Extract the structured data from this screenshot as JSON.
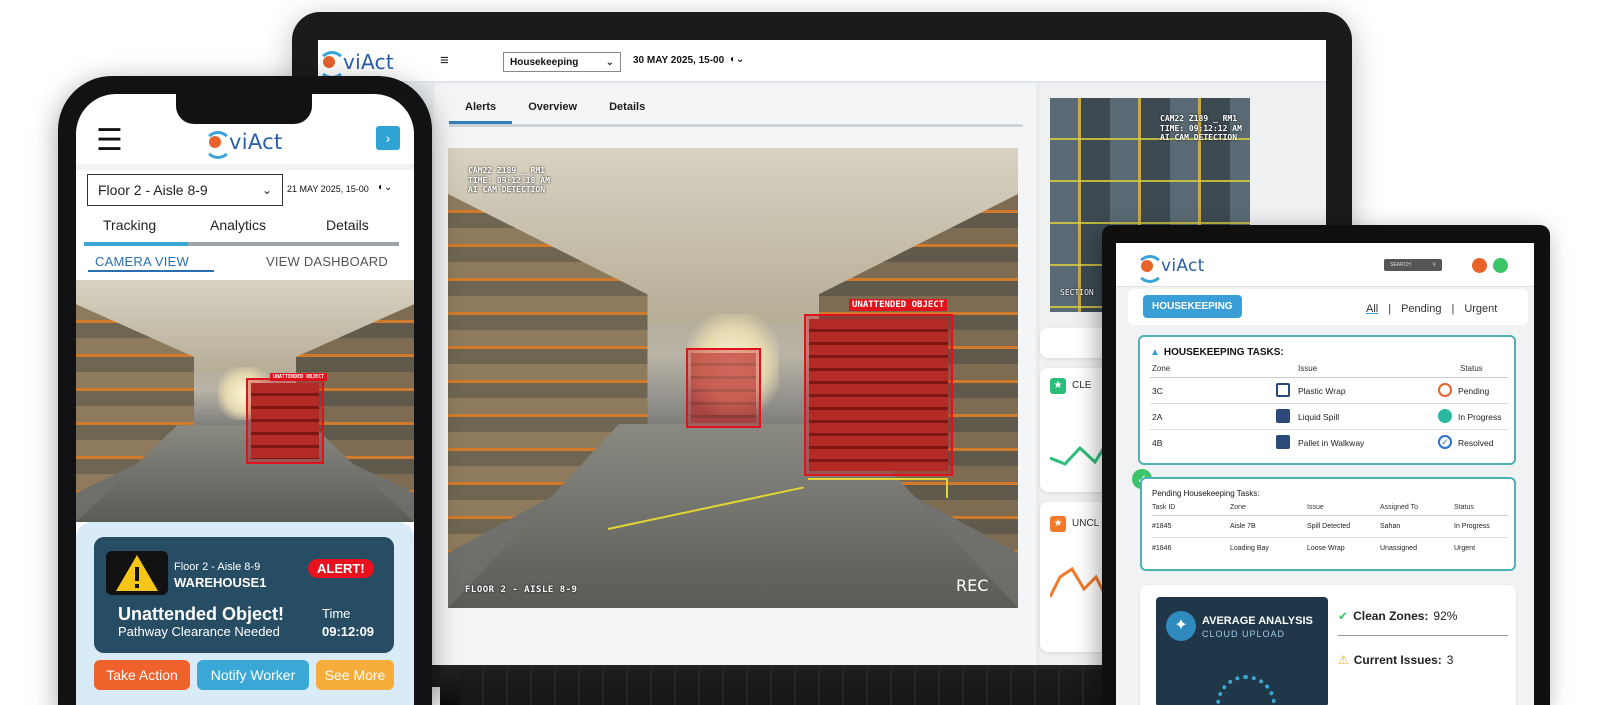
{
  "laptop": {
    "logo_text": "viAct",
    "category_select": "Housekeeping",
    "datetime": "30 MAY 2025, 15-00",
    "tabs": [
      {
        "label": "Alerts",
        "active": true
      },
      {
        "label": "Overview",
        "active": false
      },
      {
        "label": "Details",
        "active": false
      }
    ],
    "main_camera": {
      "overlay": [
        "CAM22 Z189 _ RM1",
        "TIME: 09:12:18 AM",
        "AI CAM DETECTION"
      ],
      "detection_label": "UNATTENDED OBJECT",
      "location": "FLOOR 2 - AISLE 8-9",
      "rec": "REC"
    },
    "thumb_camera": {
      "overlay": [
        "CAM22 Z189 _ RM1",
        "TIME: 09:12:12 AM",
        "AI CAM DETECTION"
      ],
      "section": "SECTION"
    },
    "side_cards": [
      {
        "label": "CLE",
        "icon": "star-icon",
        "color": "#2dbd7a"
      },
      {
        "label": "UNCL",
        "icon": "star-icon",
        "color": "#f07a2a"
      }
    ]
  },
  "tablet": {
    "logo_text": "viAct",
    "search_placeholder": "SEARCH",
    "category_pill": "HOUSEKEEPING",
    "filters": [
      "All",
      "|",
      "Pending",
      "|",
      "Urgent"
    ],
    "tasks": {
      "title": "HOUSEKEEPING TASKS:",
      "headers": [
        "Zone",
        "Issue",
        "Status"
      ],
      "rows": [
        {
          "zone": "3C",
          "issue": "Plastic Wrap",
          "status": "Pending",
          "status_color": "#e8622a"
        },
        {
          "zone": "2A",
          "issue": "Liquid Spill",
          "status": "In Progress",
          "status_color": "#2bb6a0"
        },
        {
          "zone": "4B",
          "issue": "Pallet in Walkway",
          "status": "Resolved",
          "status_color": "#2d6fd0"
        }
      ]
    },
    "pending": {
      "title": "Pending Housekeeping Tasks:",
      "headers": [
        "Task ID",
        "Zone",
        "Issue",
        "Assigned To",
        "Status"
      ],
      "rows": [
        {
          "id": "#1845",
          "zone": "Aisle 7B",
          "issue": "Spill Detected",
          "assigned": "Sahan",
          "status": "In Progress"
        },
        {
          "id": "#1846",
          "zone": "Loading Bay",
          "issue": "Loose Wrap",
          "assigned": "Unassigned",
          "status": "Urgent"
        }
      ]
    },
    "analysis": {
      "title": "AVERAGE ANALYSIS",
      "subtitle": "CLOUD UPLOAD",
      "clean_label": "Clean Zones:",
      "clean_value": "92%",
      "issues_label": "Current Issues:",
      "issues_value": "3"
    }
  },
  "phone": {
    "logo_text": "viAct",
    "location_select": "Floor 2 - Aisle 8-9",
    "datetime": "21 MAY 2025, 15-00",
    "tabs": [
      {
        "label": "Tracking",
        "active": true
      },
      {
        "label": "Analytics",
        "active": false
      },
      {
        "label": "Details",
        "active": false
      }
    ],
    "subtabs": [
      {
        "label": "CAMERA VIEW",
        "active": true
      },
      {
        "label": "VIEW DASHBOARD",
        "active": false
      }
    ],
    "detection_label": "UNATTENDED OBJECT",
    "alert": {
      "location": "Floor 2 - Aisle 8-9",
      "site": "WAREHOUSE1",
      "badge": "ALERT!",
      "title": "Unattended Object!",
      "subtitle": "Pathway Clearance Needed",
      "time_label": "Time",
      "time_value": "09:12:09"
    },
    "buttons": [
      {
        "label": "Take Action",
        "color": "#f0622c"
      },
      {
        "label": "Notify Worker",
        "color": "#3aa8d6"
      },
      {
        "label": "See More",
        "color": "#f6ad3c"
      }
    ]
  }
}
